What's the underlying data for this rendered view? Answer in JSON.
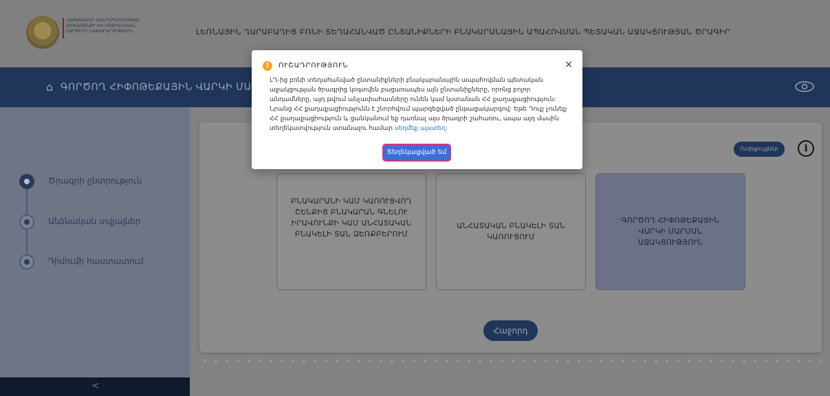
{
  "header": {
    "logo_text": [
      "ՀԱՅԱՍՏԱՆԻ ՀԱՆՐԱՊԵՏՈՒԹՅԱՆ",
      "ԱՇԽԱՏԱՆՔԻ ԵՎ ՍՈՑԻԱԼԱԿԱՆ",
      "ՀԱՐՑԵՐԻ ՆԱԽԱՐԱՐՈՒԹՅՈՒՆ"
    ],
    "title": "ԼԵՌՆԱՅԻՆ ՂԱՐԱԲԱՂԻՑ ԲՌՆԻ ՏԵՂԱՀԱՆՎԱԾ ԸՆՏԱՆԻՔՆԵՐԻ ԲՆԱԿԱՐԱՆԱՅԻՆ ԱՊԱՀՈՎՄԱՆ ՊԵՏԱԿԱՆ ԱՋԱԿՑՈՒԹՅԱՆ ԾՐԱԳԻՐ"
  },
  "band": {
    "home_icon": "home-icon",
    "title": "ԳՈՐԾՈՂ ՀԻՓՈԹԵՔԱՅԻՆ ՎԱՐԿԻ ՄԱՐՄՄԱՆ",
    "eye_icon": "eye-icon"
  },
  "sidebar": {
    "steps": [
      {
        "label": "Ծրագրի ընտրություն",
        "active": true
      },
      {
        "label": "Անձնական տվյալներ",
        "active": false
      },
      {
        "label": "Դիմումի հաստատում",
        "active": false
      }
    ],
    "collapse_label": "<"
  },
  "main": {
    "guide_button": "Ուղեցույցներ",
    "info_icon": "i",
    "options": [
      "ԲՆԱԿԱՐԱՆԻ ԿԱՄ ԿԱՌՈՒՑՎՈՂ ՇԵՆՔԻՑ ԲՆԱԿԱՐԱՆ ԳՆԵԼՈՒ ԻՐԱՎՈՒՆՔԻ ԿԱՄ ԱՆՀԱՏԱԿԱՆ ԲՆԱԿԵԼԻ ՏԱՆ ՁԵՌՔԲԵՐՈՒՄ",
      "ԱՆՀԱՏԱԿԱՆ ԲՆԱԿԵԼԻ ՏԱՆ ԿԱՌՈՒՑՈՒՄ",
      "ԳՈՐԾՈՂ ՀԻՓՈԹԵՔԱՅԻՆ ՎԱՐԿԻ ՄԱՐՄԱՆ ԱՋԱԿՑՈՒԹՅՈՒՆ"
    ],
    "next_button": "Հաջորդ"
  },
  "modal": {
    "title": "ՈՒՇԱԴՐՈՒԹՅՈՒՆ",
    "close": "×",
    "body": "ԼՂ-ից բռնի տեղահանված ընտանիքների բնակարանային ապահովման պետական աջակցության ծրագրից կօգտվեն բացառապես այն ընտանիքները, որոնց բոլոր անդամները, այդ թվում անչափահասները ունեն կամ կստանան ՀՀ քաղաքացիություն: Նրանց ՀՀ քաղաքացիությունն է շնորհվում պարզեցված ընթացակարգով: Եթե Դուք չունեք ՀՀ քաղաքացիություն և ցանկանում եք դառնալ այս ծրագրի շահառու, ապա այդ մասին տեղեկատվություն ստանալու համար",
    "link": "սեղմեք այստեղ:",
    "ok_button": "Տեղեկացված եմ"
  },
  "colors": {
    "band": "#1f3559",
    "modal_button": "#3b6fd8",
    "warning": "#f5a623",
    "link": "#1a73e8"
  }
}
